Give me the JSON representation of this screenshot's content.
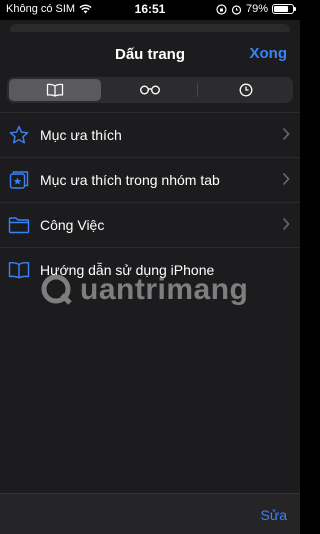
{
  "status_bar": {
    "carrier": "Không có SIM",
    "time": "16:51",
    "battery_text": "79%",
    "battery_level": 0.79
  },
  "header": {
    "title": "Dấu trang",
    "done_label": "Xong"
  },
  "tabs": [
    {
      "icon": "book-icon",
      "selected": true
    },
    {
      "icon": "reading-list-glasses-icon",
      "selected": false
    },
    {
      "icon": "history-clock-icon",
      "selected": false
    }
  ],
  "bookmarks": [
    {
      "label": "Mục ưa thích",
      "icon": "star-icon",
      "has_chevron": true
    },
    {
      "label": "Mục ưa thích trong nhóm tab",
      "icon": "tab-group-favorites-icon",
      "has_chevron": true
    },
    {
      "label": "Công Việc",
      "icon": "folder-icon",
      "has_chevron": true
    },
    {
      "label": "Hướng dẫn sử dụng iPhone",
      "icon": "book-icon",
      "has_chevron": false
    }
  ],
  "watermark": {
    "text": "uantrimang"
  },
  "toolbar": {
    "edit_label": "Sửa"
  },
  "colors": {
    "accent": "#3b82f6",
    "sheet_bg": "#1c1c1e"
  }
}
